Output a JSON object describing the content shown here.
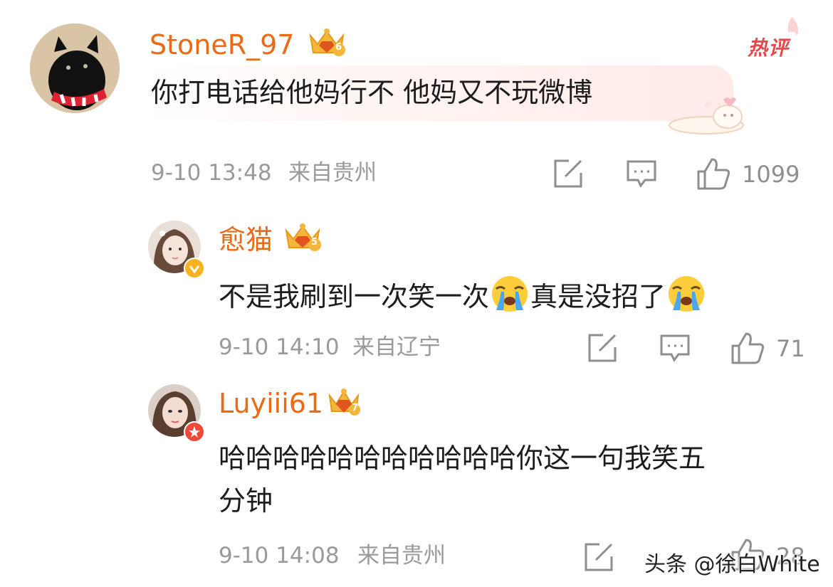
{
  "hot_badge": "热评",
  "colors": {
    "username": "#ea6a16",
    "text": "#1c1c1c",
    "meta": "#9a9a9a",
    "hot": "#e8484c"
  },
  "comments": [
    {
      "username": "StoneR_97",
      "crown_level": "6",
      "text": "你打电话给他妈行不 他妈又不玩微博",
      "time": "9-10 13:48",
      "location": "来自贵州",
      "likes": "1099"
    },
    {
      "username": "愈猫",
      "crown_level": "5",
      "text_part1": "不是我刷到一次笑一次",
      "text_part2": "真是没招了",
      "emoji": "crying-face",
      "time": "9-10 14:10",
      "location": "来自辽宁",
      "likes": "71"
    },
    {
      "username": "Luyiii61",
      "crown_level": "7",
      "text_line1": "哈哈哈哈哈哈哈哈哈哈哈你这一句我笑五",
      "text_line2": "分钟",
      "time": "9-10 14:08",
      "location": "来自贵州",
      "likes": "28"
    }
  ],
  "watermark": "头条 @徐白White"
}
